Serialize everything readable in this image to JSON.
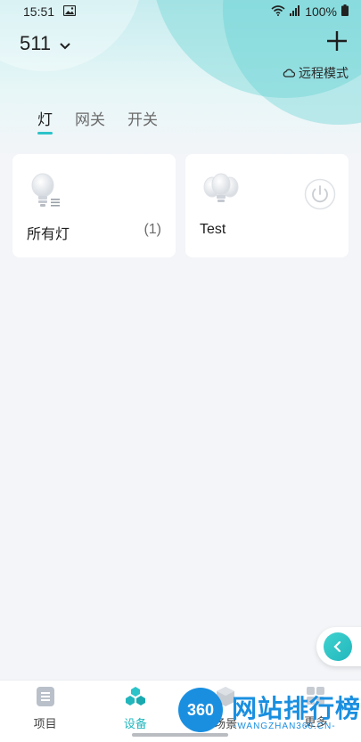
{
  "status_bar": {
    "time": "15:51",
    "battery": "100%"
  },
  "header": {
    "project_name": "511",
    "remote_mode_label": "远程模式"
  },
  "tabs": [
    {
      "label": "灯",
      "active": true
    },
    {
      "label": "网关",
      "active": false
    },
    {
      "label": "开关",
      "active": false
    }
  ],
  "devices": [
    {
      "name": "所有灯",
      "count": "(1)",
      "icon": "bulb-group-icon"
    },
    {
      "name": "Test",
      "icon": "bulbs-icon",
      "action_icon": "power-icon"
    }
  ],
  "bottom_nav": [
    {
      "label": "项目",
      "icon": "project-icon",
      "active": false
    },
    {
      "label": "设备",
      "icon": "devices-icon",
      "active": true
    },
    {
      "label": "场景",
      "icon": "scene-icon",
      "active": false
    },
    {
      "label": "更多",
      "icon": "more-icon",
      "active": false
    }
  ],
  "watermark": {
    "logo_text": "360",
    "title": "网站排行榜",
    "subtitle": "-WANGZHAN360.CN-"
  },
  "colors": {
    "accent": "#22b7bd",
    "watermark": "#1a8fe0"
  }
}
